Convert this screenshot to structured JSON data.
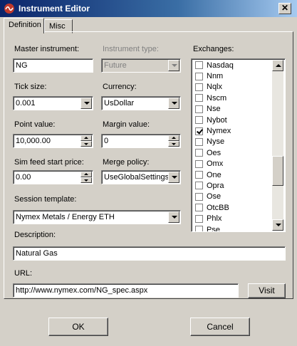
{
  "window": {
    "title": "Instrument Editor",
    "close_glyph": "✕"
  },
  "tabs": [
    {
      "label": "Definition"
    },
    {
      "label": "Misc"
    }
  ],
  "form": {
    "master_instrument": {
      "label": "Master instrument:",
      "value": "NG"
    },
    "instrument_type": {
      "label": "Instrument type:",
      "value": "Future"
    },
    "tick_size": {
      "label": "Tick size:",
      "value": "0.001"
    },
    "currency": {
      "label": "Currency:",
      "value": "UsDollar"
    },
    "point_value": {
      "label": "Point value:",
      "value": "10,000.00"
    },
    "margin_value": {
      "label": "Margin value:",
      "value": "0"
    },
    "sim_feed_start_price": {
      "label": "Sim feed start price:",
      "value": "0.00"
    },
    "merge_policy": {
      "label": "Merge policy:",
      "value": "UseGlobalSettings"
    },
    "session_template": {
      "label": "Session template:",
      "value": "Nymex Metals / Energy ETH"
    },
    "description": {
      "label": "Description:",
      "value": "Natural Gas"
    },
    "url": {
      "label": "URL:",
      "value": "http://www.nymex.com/NG_spec.aspx"
    },
    "visit_label": "Visit"
  },
  "exchanges": {
    "label": "Exchanges:",
    "items": [
      {
        "name": "Nasdaq",
        "checked": false
      },
      {
        "name": "Nnm",
        "checked": false
      },
      {
        "name": "Nqlx",
        "checked": false
      },
      {
        "name": "Nscm",
        "checked": false
      },
      {
        "name": "Nse",
        "checked": false
      },
      {
        "name": "Nybot",
        "checked": false
      },
      {
        "name": "Nymex",
        "checked": true
      },
      {
        "name": "Nyse",
        "checked": false
      },
      {
        "name": "Oes",
        "checked": false
      },
      {
        "name": "Omx",
        "checked": false
      },
      {
        "name": "One",
        "checked": false
      },
      {
        "name": "Opra",
        "checked": false
      },
      {
        "name": "Ose",
        "checked": false
      },
      {
        "name": "OtcBB",
        "checked": false
      },
      {
        "name": "Phlx",
        "checked": false
      },
      {
        "name": "Pse",
        "checked": false
      }
    ]
  },
  "footer": {
    "ok_label": "OK",
    "cancel_label": "Cancel"
  },
  "icons": {
    "app": "instrument-app-icon",
    "close": "close-icon",
    "dropdown": "chevron-down-icon",
    "spin_up": "spin-up-icon",
    "spin_down": "spin-down-icon",
    "checkbox": "checkbox-icon",
    "scroll_up": "scroll-up-icon",
    "scroll_down": "scroll-down-icon"
  },
  "colors": {
    "titlebar_start": "#0a246a",
    "titlebar_end": "#a6caf0",
    "dialog_face": "#d4d0c8",
    "disabled_text": "#808080"
  }
}
